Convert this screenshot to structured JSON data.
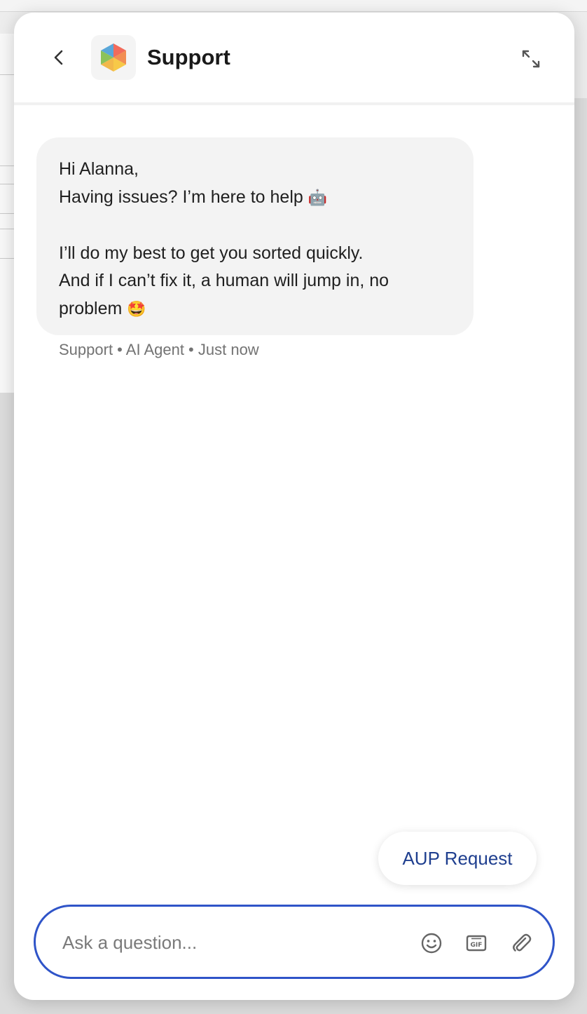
{
  "header": {
    "title": "Support",
    "back_icon": "chevron-left-icon",
    "expand_icon": "expand-arrows-icon",
    "logo_icon": "hexagon-logo-icon"
  },
  "message": {
    "lines": [
      "Hi Alanna,",
      "Having issues? I’m here to help",
      "I’ll do my best to get you sorted quickly.",
      "And if I can’t fix it, a human will jump in, no",
      "problem"
    ],
    "emoji_robot": "🤖",
    "emoji_starstruck": "🤩",
    "meta": "Support • AI Agent • Just now"
  },
  "quick_reply": {
    "label": "AUP Request"
  },
  "composer": {
    "placeholder": "Ask a question...",
    "value": "",
    "tools": [
      "emoji-icon",
      "gif-icon",
      "paperclip-icon"
    ]
  },
  "colors": {
    "accent": "#2f54c8",
    "quick_reply_text": "#1f3f8f",
    "bubble_bg": "#f3f3f3",
    "meta_text": "#737373"
  }
}
